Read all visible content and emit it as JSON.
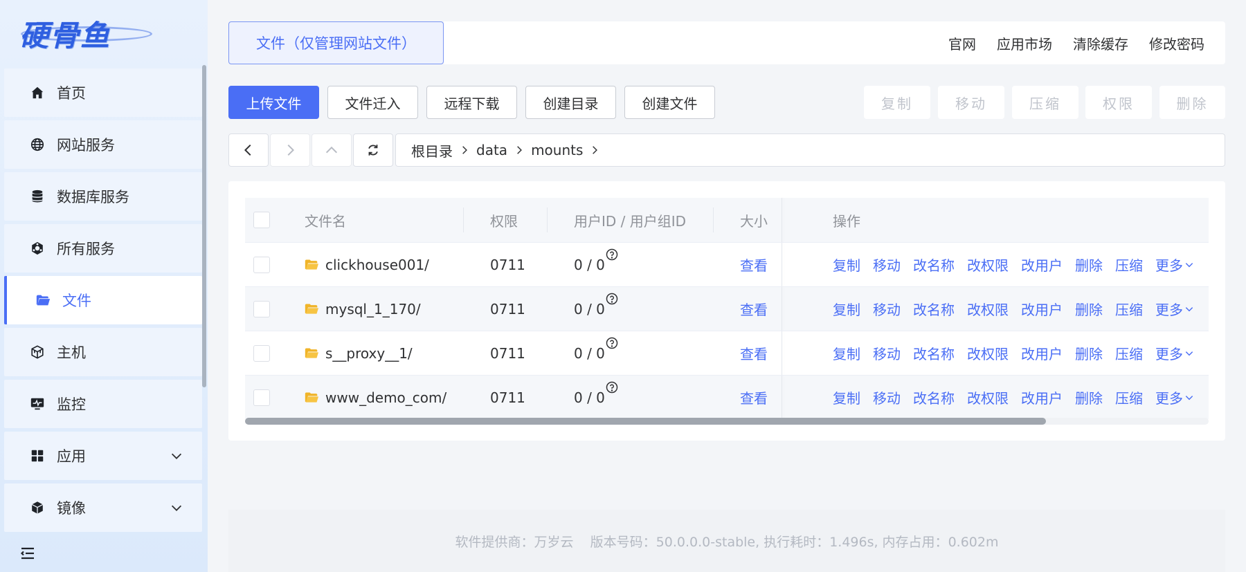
{
  "sidebar": {
    "logo_text": "硬骨鱼",
    "items": [
      {
        "label": "首页",
        "icon": "home-icon"
      },
      {
        "label": "网站服务",
        "icon": "globe-icon"
      },
      {
        "label": "数据库服务",
        "icon": "database-icon"
      },
      {
        "label": "所有服务",
        "icon": "services-icon"
      },
      {
        "label": "文件",
        "icon": "folder-open-icon",
        "active": true
      },
      {
        "label": "主机",
        "icon": "host-cube-icon"
      },
      {
        "label": "监控",
        "icon": "monitor-icon"
      },
      {
        "label": "应用",
        "icon": "apps-grid-icon",
        "expandable": true
      },
      {
        "label": "镜像",
        "icon": "image-box-icon",
        "expandable": true
      }
    ]
  },
  "header": {
    "tab_label": "文件（仅管理网站文件）",
    "links": [
      "官网",
      "应用市场",
      "清除缓存",
      "修改密码"
    ]
  },
  "toolbar": {
    "upload": "上传文件",
    "import": "文件迁入",
    "remote_download": "远程下载",
    "create_dir": "创建目录",
    "create_file": "创建文件",
    "copy": "复制",
    "move": "移动",
    "compress": "压缩",
    "permission": "权限",
    "delete": "删除"
  },
  "path": {
    "crumbs": [
      "根目录",
      "data",
      "mounts"
    ]
  },
  "table": {
    "columns": {
      "name": "文件名",
      "perm": "权限",
      "owner": "用户ID / 用户组ID",
      "size": "大小",
      "ops": "操作"
    },
    "rows": [
      {
        "name": "clickhouse001/",
        "perm": "0711",
        "owner": "0 / 0",
        "size": "查看"
      },
      {
        "name": "mysql_1_170/",
        "perm": "0711",
        "owner": "0 / 0",
        "size": "查看"
      },
      {
        "name": "s__proxy__1/",
        "perm": "0711",
        "owner": "0 / 0",
        "size": "查看"
      },
      {
        "name": "www_demo_com/",
        "perm": "0711",
        "owner": "0 / 0",
        "size": "查看"
      }
    ],
    "ops": [
      "复制",
      "移动",
      "改名称",
      "改权限",
      "改用户",
      "删除",
      "压缩",
      "更多"
    ]
  },
  "footer": {
    "text": "软件提供商：万岁云    版本号码：50.0.0.0-stable, 执行耗时：1.496s, 内存占用：0.602m"
  },
  "colors": {
    "accent": "#4a6ef5",
    "folder": "#f7c443",
    "sidebar_bg": "#e3eefc"
  }
}
